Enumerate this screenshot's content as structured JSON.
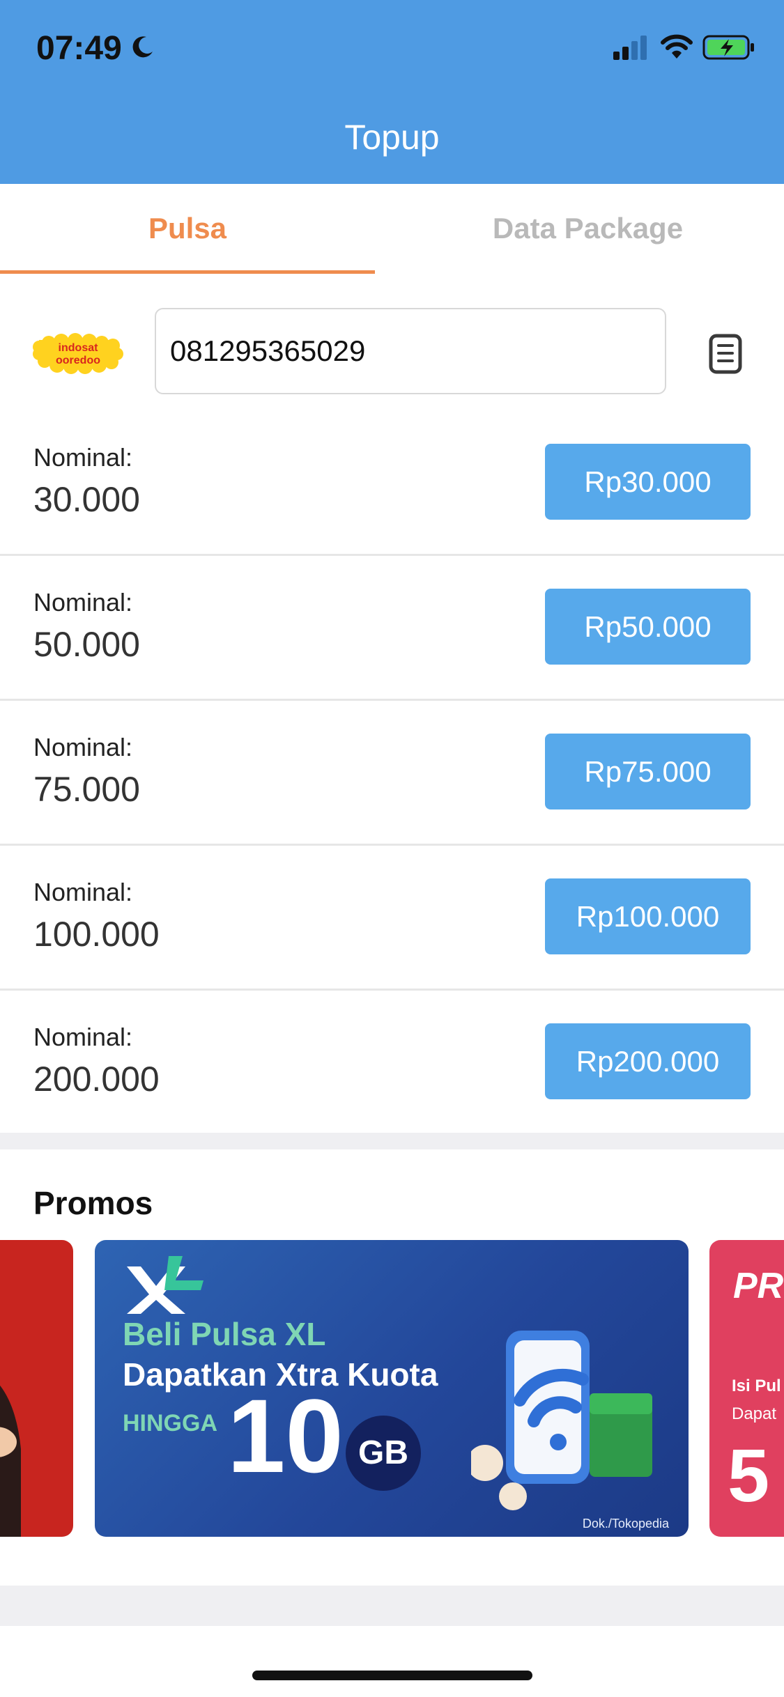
{
  "status_bar": {
    "time": "07:49"
  },
  "header": {
    "title": "Topup"
  },
  "tabs": [
    {
      "label": "Pulsa",
      "active": true
    },
    {
      "label": "Data Package",
      "active": false
    }
  ],
  "operator": {
    "name": "indosat ooredoo",
    "logo_line1": "indosat",
    "logo_line2": "ooredoo"
  },
  "phone_input": {
    "value": "081295365029"
  },
  "nominals": [
    {
      "label": "Nominal:",
      "value": "30.000",
      "price": "Rp30.000"
    },
    {
      "label": "Nominal:",
      "value": "50.000",
      "price": "Rp50.000"
    },
    {
      "label": "Nominal:",
      "value": "75.000",
      "price": "Rp75.000"
    },
    {
      "label": "Nominal:",
      "value": "100.000",
      "price": "Rp100.000"
    },
    {
      "label": "Nominal:",
      "value": "200.000",
      "price": "Rp200.000"
    }
  ],
  "promos": {
    "title": "Promos",
    "main": {
      "brand": "XL",
      "line1": "Beli Pulsa XL",
      "line2": "Dapatkan Xtra Kuota",
      "line3": "HINGGA",
      "big_number": "10",
      "unit": "GB",
      "credit": "Dok./Tokopedia"
    },
    "right": {
      "top": "PR",
      "line1": "Isi Pul",
      "line2": "Dapat",
      "big": "5"
    }
  },
  "colors": {
    "header": "#4f9be3",
    "accent": "#ef8c4e",
    "button": "#57a9eb",
    "inactive_tab": "#b9b9b9"
  },
  "icons": [
    "moon-icon",
    "signal-icon",
    "wifi-icon",
    "battery-icon",
    "contacts-icon"
  ]
}
